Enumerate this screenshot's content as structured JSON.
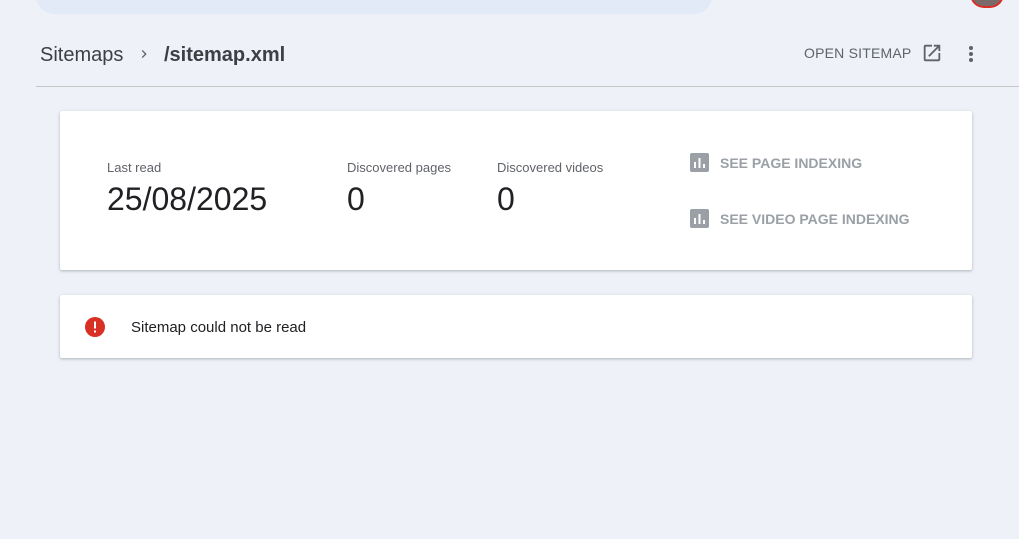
{
  "breadcrumb": {
    "root": "Sitemaps",
    "current": "/sitemap.xml"
  },
  "actions": {
    "open_sitemap": "OPEN SITEMAP",
    "open_icon": "open-in-new-icon",
    "more_icon": "more-vert-icon"
  },
  "stats": {
    "last_read_label": "Last read",
    "last_read_value": "25/08/2025",
    "pages_label": "Discovered pages",
    "pages_value": "0",
    "videos_label": "Discovered videos",
    "videos_value": "0"
  },
  "links": {
    "page_indexing": "SEE PAGE INDEXING",
    "video_indexing": "SEE VIDEO PAGE INDEXING",
    "icon": "bar-chart-icon"
  },
  "error": {
    "message": "Sitemap could not be read",
    "icon": "error-icon",
    "color": "#d93025"
  },
  "colors": {
    "background": "#eef2f8",
    "card": "#ffffff",
    "muted_link": "#9aa0a6"
  }
}
